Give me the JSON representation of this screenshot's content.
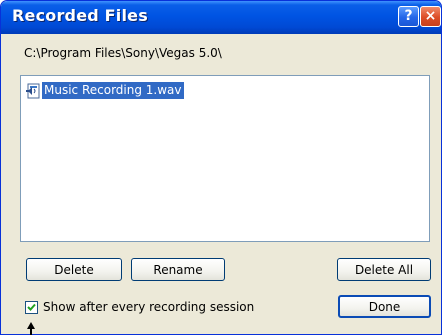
{
  "window": {
    "title": "Recorded Files",
    "help_glyph": "?",
    "close_glyph": "×"
  },
  "path_text": "C:\\Program Files\\Sony\\Vegas 5.0\\",
  "files": [
    {
      "name": "Music Recording 1.wav",
      "icon": "audio-file-icon",
      "selected": true
    }
  ],
  "buttons": {
    "delete": "Delete",
    "rename": "Rename",
    "delete_all": "Delete All",
    "done": "Done"
  },
  "option": {
    "label": "Show after every recording session",
    "checked": true
  },
  "colors": {
    "titlebar": "#0054e3",
    "selection": "#316ac5",
    "dialog_bg": "#ece9d8",
    "check_mark": "#21a121"
  }
}
